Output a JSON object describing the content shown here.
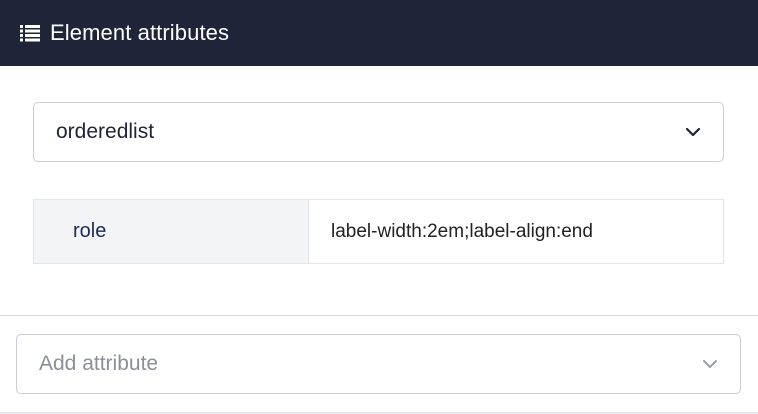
{
  "header": {
    "title": "Element attributes",
    "icon": "list-icon",
    "background": "#1f2438"
  },
  "element_select": {
    "value": "orderedlist",
    "icon": "chevron-down-icon"
  },
  "attributes": [
    {
      "key": "role",
      "value": "label-width:2em;label-align:end"
    }
  ],
  "add_attribute": {
    "placeholder": "Add attribute",
    "icon": "chevron-down-icon"
  }
}
